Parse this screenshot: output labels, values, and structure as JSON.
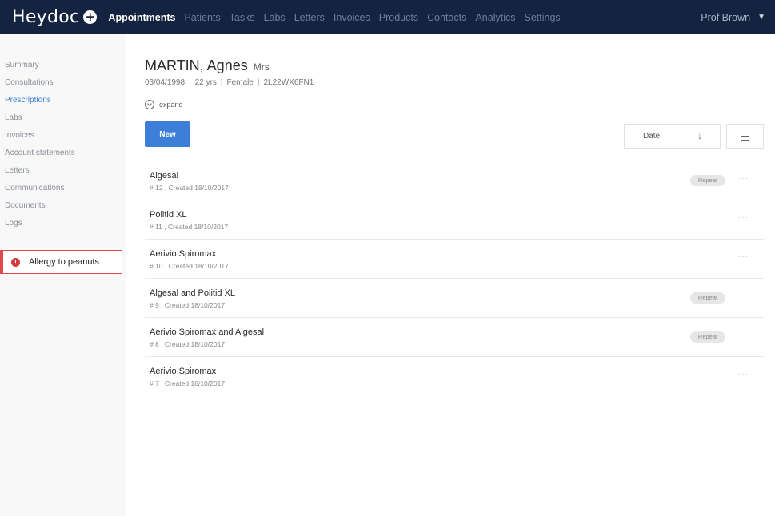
{
  "app": {
    "logo": "Heydoc",
    "logo_plus": "+"
  },
  "nav": {
    "items": [
      {
        "label": "Appointments",
        "active": true
      },
      {
        "label": "Patients"
      },
      {
        "label": "Tasks"
      },
      {
        "label": "Labs"
      },
      {
        "label": "Letters"
      },
      {
        "label": "Invoices"
      },
      {
        "label": "Products"
      },
      {
        "label": "Contacts"
      },
      {
        "label": "Analytics"
      },
      {
        "label": "Settings"
      }
    ],
    "user": "Prof Brown",
    "user_caret": "▼"
  },
  "sidebar": {
    "items": [
      {
        "label": "Summary"
      },
      {
        "label": "Consultations"
      },
      {
        "label": "Prescriptions",
        "active": true
      },
      {
        "label": "Labs"
      },
      {
        "label": "Invoices"
      },
      {
        "label": "Account statements"
      },
      {
        "label": "Letters"
      },
      {
        "label": "Communications"
      },
      {
        "label": "Documents"
      },
      {
        "label": "Logs"
      }
    ],
    "allergy": {
      "icon": "!",
      "label": "Allergy to peanuts"
    }
  },
  "patient": {
    "name": "MARTIN, Agnes",
    "title": "Mrs",
    "dob": "03/04/1998",
    "age": "22 yrs",
    "sex": "Female",
    "nhs": "2L22WX6FN1",
    "separator": "|",
    "expand_label": "expand"
  },
  "toolbar": {
    "new_label": "New",
    "sort_label": "Date",
    "sort_arrow": "↓"
  },
  "prescriptions": [
    {
      "name": "Algesal",
      "sub": "# 12 , Created 18/10/2017",
      "badge": "Repeat"
    },
    {
      "name": "Politid XL",
      "sub": "# 11 , Created 18/10/2017",
      "badge": ""
    },
    {
      "name": "Aerivio Spiromax",
      "sub": "# 10 , Created 18/10/2017",
      "badge": ""
    },
    {
      "name": "Algesal and Politid XL",
      "sub": "# 9 , Created 18/10/2017",
      "badge": "Repeat"
    },
    {
      "name": "Aerivio Spiromax and Algesal",
      "sub": "# 8 , Created 18/10/2017",
      "badge": "Repeat"
    },
    {
      "name": "Aerivio Spiromax",
      "sub": "# 7 , Created 18/10/2017",
      "badge": ""
    }
  ],
  "more_glyph": "···",
  "colors": {
    "topbar": "#14233f",
    "accent": "#3d7fd8",
    "allergy": "#e2474d"
  }
}
